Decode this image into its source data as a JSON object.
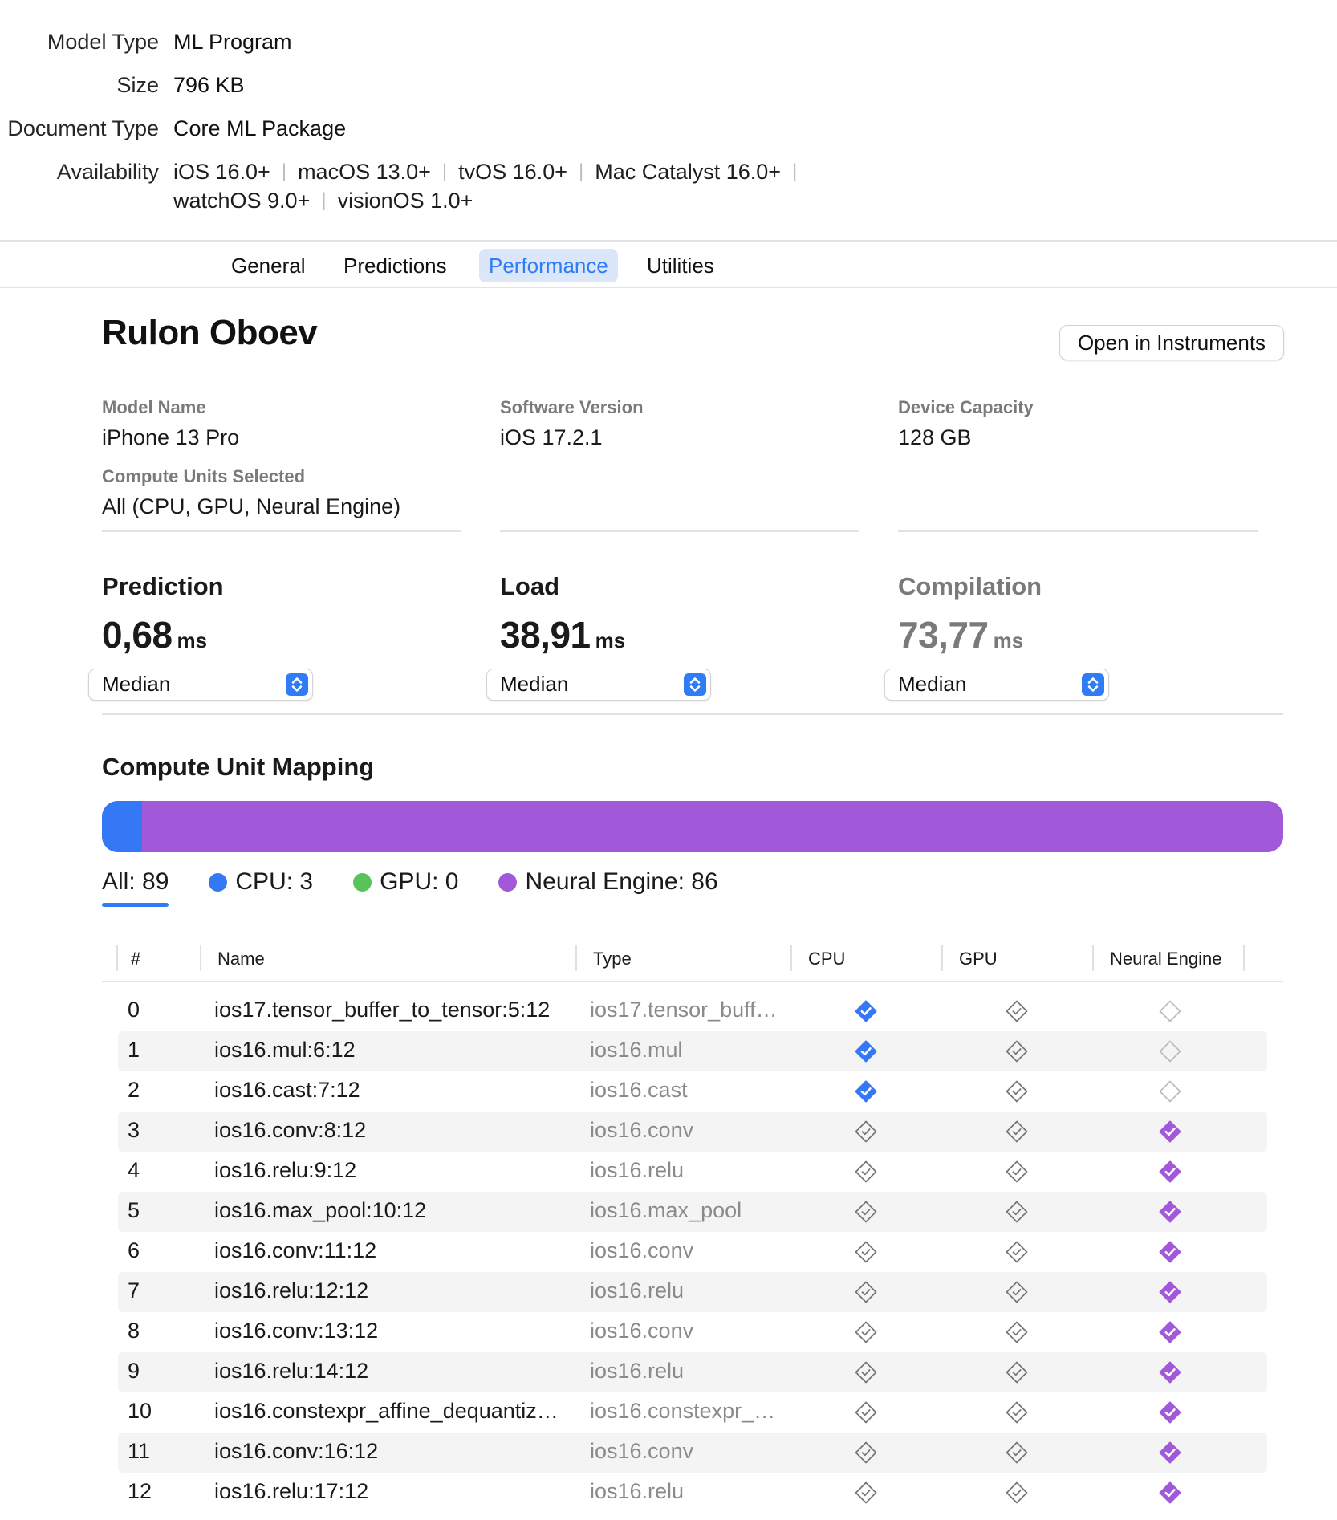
{
  "metadata": {
    "rows": [
      {
        "label": "Model Type",
        "value": "ML Program"
      },
      {
        "label": "Size",
        "value": "796 KB"
      },
      {
        "label": "Document Type",
        "value": "Core ML Package"
      }
    ],
    "availability_label": "Availability",
    "availability": [
      "iOS 16.0+",
      "macOS 13.0+",
      "tvOS 16.0+",
      "Mac Catalyst 16.0+",
      "watchOS 9.0+",
      "visionOS 1.0+"
    ]
  },
  "tabs": [
    {
      "label": "General",
      "active": false
    },
    {
      "label": "Predictions",
      "active": false
    },
    {
      "label": "Performance",
      "active": true
    },
    {
      "label": "Utilities",
      "active": false
    }
  ],
  "performance": {
    "title": "Rulon Oboev",
    "open_instruments_label": "Open in Instruments",
    "device": {
      "model_name_label": "Model Name",
      "model_name": "iPhone 13 Pro",
      "software_version_label": "Software Version",
      "software_version": "iOS 17.2.1",
      "device_capacity_label": "Device Capacity",
      "device_capacity": "128 GB",
      "compute_units_label": "Compute Units Selected",
      "compute_units": "All (CPU, GPU, Neural Engine)"
    },
    "metrics": [
      {
        "title": "Prediction",
        "value": "0,68",
        "unit": "ms",
        "stat": "Median",
        "muted": false
      },
      {
        "title": "Load",
        "value": "38,91",
        "unit": "ms",
        "stat": "Median",
        "muted": false
      },
      {
        "title": "Compilation",
        "value": "73,77",
        "unit": "ms",
        "stat": "Median",
        "muted": true
      }
    ]
  },
  "mapping": {
    "title": "Compute Unit Mapping",
    "colors": {
      "cpu": "#3478f6",
      "gpu": "#5ac25a",
      "ane": "#a259d9"
    },
    "counts": {
      "all": 89,
      "cpu": 3,
      "gpu": 0,
      "ane": 86
    },
    "legend": {
      "all": "All: 89",
      "cpu": "CPU: 3",
      "gpu": "GPU: 0",
      "ane": "Neural Engine: 86"
    }
  },
  "table": {
    "headers": {
      "index": "#",
      "name": "Name",
      "type": "Type",
      "cpu": "CPU",
      "gpu": "GPU",
      "ane": "Neural Engine"
    },
    "rows": [
      {
        "i": "0",
        "name": "ios17.tensor_buffer_to_tensor:5:12",
        "type": "ios17.tensor_buff…",
        "unit": "cpu",
        "ane_supported": false
      },
      {
        "i": "1",
        "name": "ios16.mul:6:12",
        "type": "ios16.mul",
        "unit": "cpu",
        "ane_supported": false
      },
      {
        "i": "2",
        "name": "ios16.cast:7:12",
        "type": "ios16.cast",
        "unit": "cpu",
        "ane_supported": false
      },
      {
        "i": "3",
        "name": "ios16.conv:8:12",
        "type": "ios16.conv",
        "unit": "ane",
        "ane_supported": true
      },
      {
        "i": "4",
        "name": "ios16.relu:9:12",
        "type": "ios16.relu",
        "unit": "ane",
        "ane_supported": true
      },
      {
        "i": "5",
        "name": "ios16.max_pool:10:12",
        "type": "ios16.max_pool",
        "unit": "ane",
        "ane_supported": true
      },
      {
        "i": "6",
        "name": "ios16.conv:11:12",
        "type": "ios16.conv",
        "unit": "ane",
        "ane_supported": true
      },
      {
        "i": "7",
        "name": "ios16.relu:12:12",
        "type": "ios16.relu",
        "unit": "ane",
        "ane_supported": true
      },
      {
        "i": "8",
        "name": "ios16.conv:13:12",
        "type": "ios16.conv",
        "unit": "ane",
        "ane_supported": true
      },
      {
        "i": "9",
        "name": "ios16.relu:14:12",
        "type": "ios16.relu",
        "unit": "ane",
        "ane_supported": true
      },
      {
        "i": "10",
        "name": "ios16.constexpr_affine_dequantiz…",
        "type": "ios16.constexpr_…",
        "unit": "ane",
        "ane_supported": true
      },
      {
        "i": "11",
        "name": "ios16.conv:16:12",
        "type": "ios16.conv",
        "unit": "ane",
        "ane_supported": true
      },
      {
        "i": "12",
        "name": "ios16.relu:17:12",
        "type": "ios16.relu",
        "unit": "ane",
        "ane_supported": true
      }
    ]
  }
}
